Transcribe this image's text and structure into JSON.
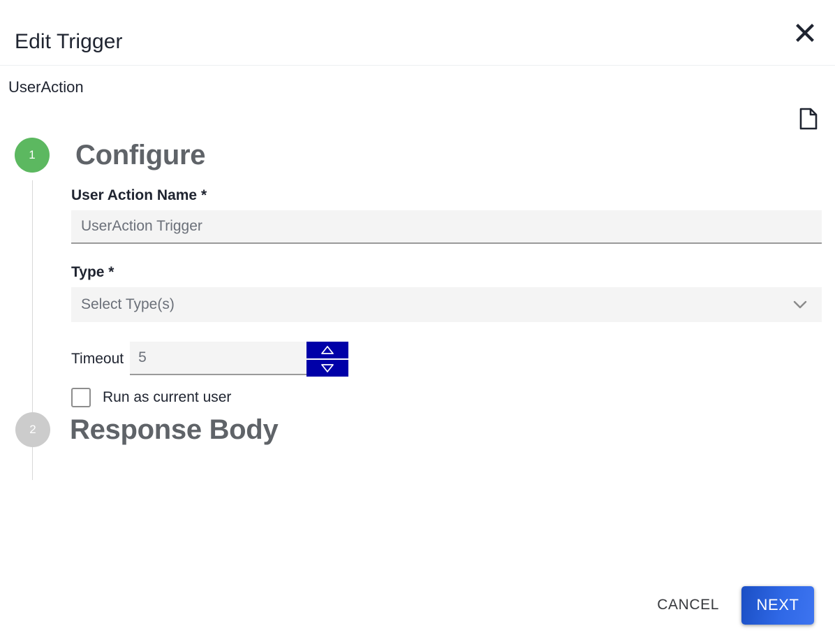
{
  "header": {
    "title": "Edit Trigger",
    "close_icon": "close-icon"
  },
  "sub_header": {
    "title": "UserAction",
    "doc_icon": "document-icon"
  },
  "steps": [
    {
      "number": "1",
      "label": "Configure",
      "state": "active",
      "badge_color": "#5cb860"
    },
    {
      "number": "2",
      "label": "Response Body",
      "state": "inactive",
      "badge_color": "#cccccc"
    }
  ],
  "form": {
    "user_action_name": {
      "label": "User Action Name *",
      "value": "",
      "placeholder": "UserAction Trigger"
    },
    "type": {
      "label": "Type *",
      "value": "Select Type(s)",
      "chevron_icon": "chevron-down-icon"
    },
    "timeout": {
      "label": "Timeout",
      "value": "5",
      "increment_icon": "triangle-up-icon",
      "decrement_icon": "triangle-down-icon"
    },
    "run_as_current_user": {
      "label": "Run as current user",
      "checked": false
    }
  },
  "footer": {
    "cancel_label": "CANCEL",
    "next_label": "NEXT"
  },
  "colors": {
    "accent_blue": "#2f68e6",
    "spinner_navy": "#0000a8",
    "step_active_green": "#5cb860",
    "step_inactive_gray": "#cccccc",
    "field_bg": "#f4f4f4"
  }
}
